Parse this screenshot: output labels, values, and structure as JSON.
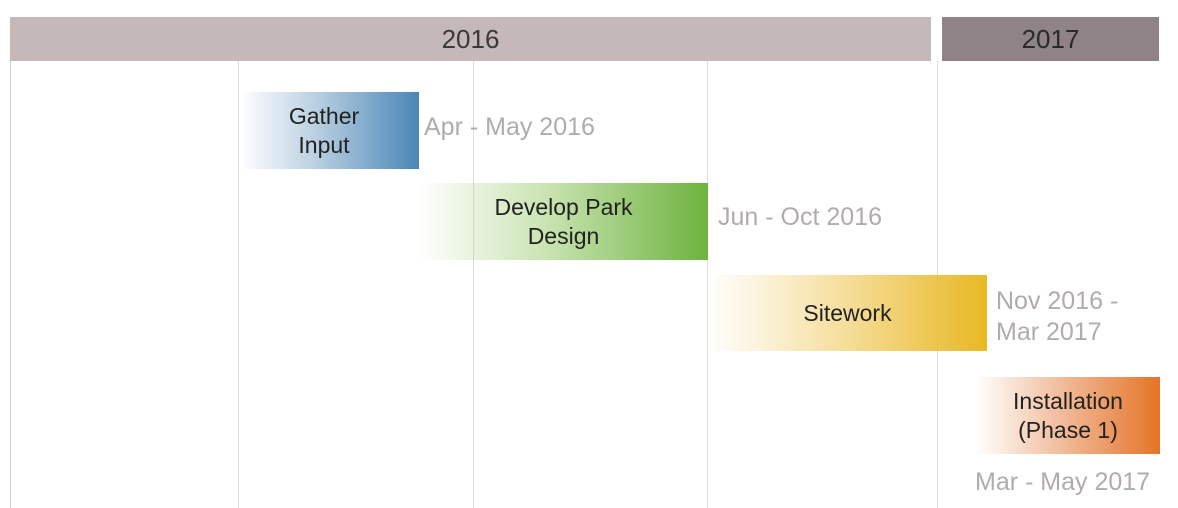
{
  "timeline": {
    "years": [
      {
        "label": "2016"
      },
      {
        "label": "2017"
      }
    ],
    "tasks": [
      {
        "name": "Gather\nInput",
        "dates": "Apr - May 2016",
        "color": "#4a86b6"
      },
      {
        "name": "Develop Park\nDesign",
        "dates": "Jun - Oct 2016",
        "color": "#6db33f"
      },
      {
        "name": "Sitework",
        "dates": "Nov 2016 -\nMar 2017",
        "color": "#e9b824"
      },
      {
        "name": "Installation\n(Phase 1)",
        "dates": "Mar - May 2017",
        "color": "#e57428"
      }
    ]
  }
}
